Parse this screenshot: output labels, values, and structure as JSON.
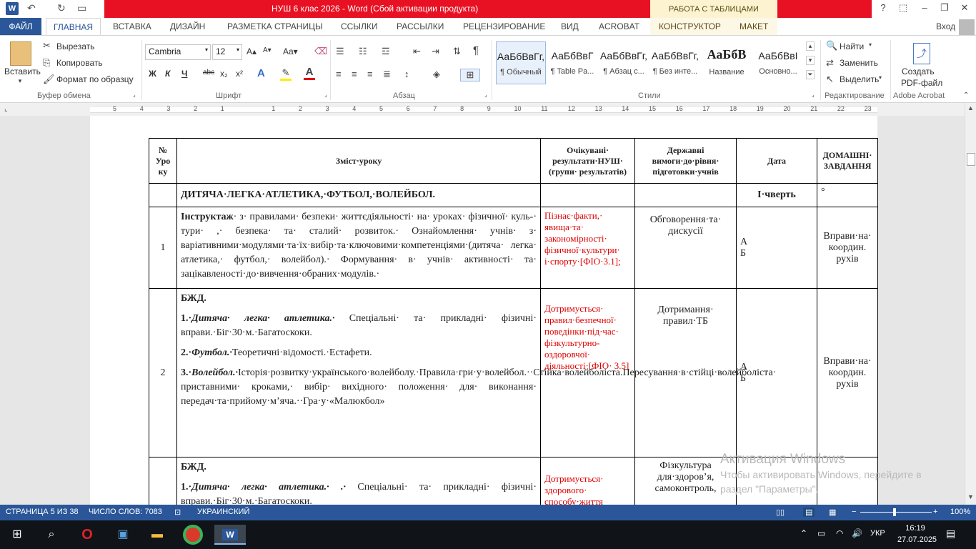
{
  "titlebar": {
    "title": "НУШ 6 клас 2026 -  Word (Сбой активации продукта)",
    "table_tools": "РАБОТА С ТАБЛИЦАМИ",
    "help": "?",
    "minimize": "–",
    "restore": "❐",
    "close": "✕"
  },
  "tabs": {
    "file": "ФАЙЛ",
    "items": [
      "ГЛАВНАЯ",
      "ВСТАВКА",
      "ДИЗАЙН",
      "РАЗМЕТКА СТРАНИЦЫ",
      "ССЫЛКИ",
      "РАССЫЛКИ",
      "РЕЦЕНЗИРОВАНИЕ",
      "ВИД",
      "ACROBAT"
    ],
    "contextual": [
      "КОНСТРУКТОР",
      "МАКЕТ"
    ],
    "signin": "Вход"
  },
  "clipboard": {
    "paste": "Вставить",
    "cut": "Вырезать",
    "copy": "Копировать",
    "format_painter": "Формат по образцу",
    "group": "Буфер обмена"
  },
  "font": {
    "name": "Cambria",
    "size": "12",
    "group": "Шрифт",
    "bold": "Ж",
    "italic": "К",
    "underline": "Ч",
    "strike": "abc",
    "subscript": "x₂",
    "superscript": "x²",
    "grow": "A▴",
    "shrink": "A▾",
    "case": "Aa▾"
  },
  "paragraph": {
    "group": "Абзац"
  },
  "styles": {
    "group": "Стили",
    "items": [
      {
        "sample": "АаБбВвГг,",
        "name": "¶ Обычный"
      },
      {
        "sample": "АаБбВвГ",
        "name": "¶ Table Pa..."
      },
      {
        "sample": "АаБбВвГг,",
        "name": "¶ Абзац с..."
      },
      {
        "sample": "АаБбВвГг,",
        "name": "¶ Без инте..."
      },
      {
        "sample": "АаБбВ",
        "name": "Название"
      },
      {
        "sample": "АаБбВвІ",
        "name": "Основно..."
      }
    ]
  },
  "editing": {
    "group": "Редактирование",
    "find": "Найти",
    "replace": "Заменить",
    "select": "Выделить"
  },
  "acrobat": {
    "group": "Adobe Acrobat",
    "create_line1": "Создать",
    "create_line2": "PDF-файл"
  },
  "ruler": [
    "5",
    "4",
    "3",
    "2",
    "1",
    "1",
    "2",
    "3",
    "4",
    "5",
    "6",
    "7",
    "8",
    "9",
    "10",
    "11",
    "12",
    "13",
    "14",
    "15",
    "16",
    "17",
    "18",
    "19",
    "20",
    "21",
    "22",
    "23"
  ],
  "table": {
    "headers": [
      "№ Уро ку",
      "Зміст·уроку",
      "Очікувані· результати·НУШ· (групи· результатів)",
      "Державні вимоги·до·рівня· підготовки·учнів",
      "Дата",
      "ДОМАШНІ· ЗАВДАННЯ"
    ],
    "section_row": {
      "title": "ДИТЯЧА·ЛЕГКА·АТЛЕТИКА,·ФУТБОЛ,·ВОЛЕЙБОЛ.",
      "quarter": "І·чверть",
      "hw": "°"
    },
    "rows": [
      {
        "num": "1",
        "content_bold": "Інструктаж",
        "content": "· з· правилами· безпеки· життєдіяльності· на· уроках· фізичної· куль-· тури· ,· безпека· та· сталий· розвиток.· Ознайомлення· учнів· з· варіативними·модулями·та·їх·вибір·та·ключовими·компетенціями·(дитяча· легка· атлетика,· футбол,· волейбол).· Формування· в· учнів· активності· та· зацікавленості·до·вивчення·обраних·модулів.·",
        "results": "Пізнає·факти,· явища·та· закономірності· фізичної·культури· і·спорту·[ФІО·3.1];",
        "requirements": "Обговорення·та· дискусії",
        "date_a": "А",
        "date_b": "Б",
        "homework": "Вправи·на· координ. рухів"
      },
      {
        "num": "2",
        "bzd": "БЖД.",
        "p1_num": "1.·",
        "p1_title": "Дитяча· легка· атлетика.·",
        "p1_text": " Спеціальні· та· прикладні· фізичні· вправи.·Біг·30·м.·Багатоскоки.",
        "p2_num": "2.·",
        "p2_title": "Футбол.·",
        "p2_text": "Теоретичні·відомості.·Естафети.",
        "p3_num": "3.·",
        "p3_title": "Волейбол.·",
        "p3_text": "Історія·розвитку·українського·волейболу.·Правила·гри·у·волейбол.··Стійка·волейболіста.Пересування·в·стійці·волейболіста· приставними· кроками,· вибір· вихідного· положення· для· виконання· передач·та·прийому·м’яча.··Гра·у·«Малюкбол»",
        "results": "Дотримується· правил·безпечної· поведінки·під·час· фізкультурно- оздоровчої· діяльності·[ФІО· 3.5]",
        "requirements": "Дотримання· правил·ТБ",
        "date_a": "А",
        "date_b": "Б",
        "homework": "Вправи·на· координ. рухів"
      },
      {
        "num": "",
        "bzd": "БЖД.",
        "p1_num": "1.·",
        "p1_title": "Дитяча· легка· атлетика.· .·",
        "p1_text": " Спеціальні· та· прикладні· фізичні· вправи.·Біг·30·м.·Багатоскоки.",
        "results": "Дотримується· здорового· способу·життя",
        "requirements": "Фізкультура для·здоров’я, самоконтроль,"
      }
    ]
  },
  "watermark": {
    "title": "Активация Windows",
    "text": "Чтобы активировать Windows, перейдите в раздел \"Параметры\"."
  },
  "status": {
    "page": "СТРАНИЦА 5 ИЗ 38",
    "words": "ЧИСЛО СЛОВ: 7083",
    "lang": "УКРАИНСКИЙ",
    "zoom": "100%"
  },
  "taskbar": {
    "lang": "УКР",
    "time": "16:19",
    "date": "27.07.2025"
  }
}
